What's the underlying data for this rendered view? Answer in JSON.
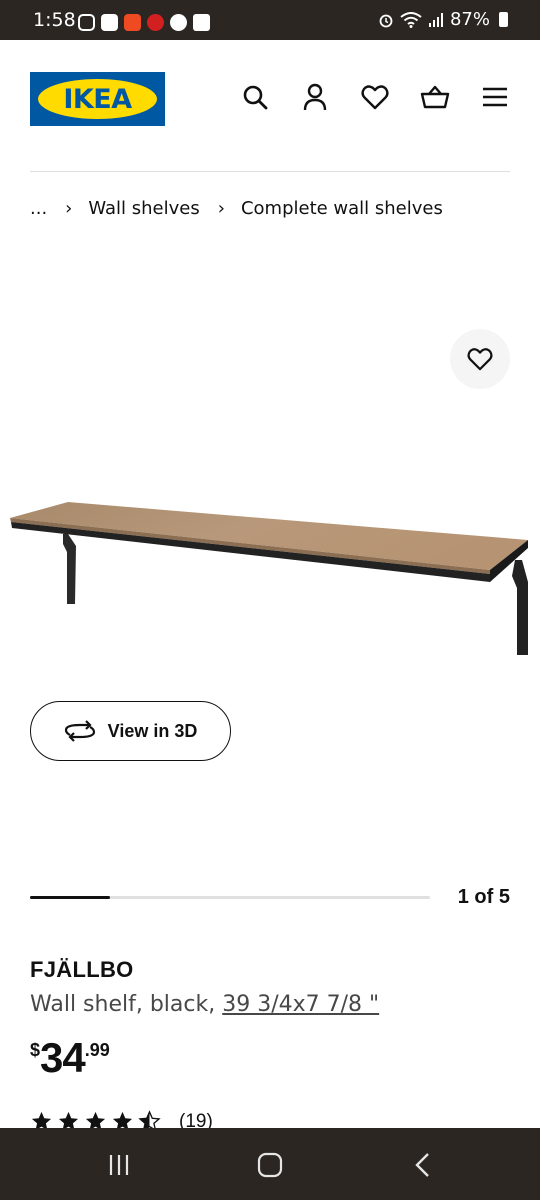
{
  "status_bar": {
    "time": "1:58",
    "battery": "87%"
  },
  "header": {
    "logo_text": "IKEA",
    "icons": [
      "search-icon",
      "account-icon",
      "heart-icon",
      "basket-icon",
      "menu-icon"
    ]
  },
  "breadcrumb": {
    "ellipsis": "...",
    "items": [
      "Wall shelves",
      "Complete wall shelves"
    ],
    "separator": "›"
  },
  "gallery": {
    "view3d_label": "View in 3D",
    "page_text": "1 of 5",
    "page_current": 1,
    "page_total": 5
  },
  "product": {
    "name": "FJÄLLBO",
    "desc_prefix": "Wall shelf, black, ",
    "size": "39 3/4x7 7/8 \"",
    "price_currency": "$",
    "price_int": "34",
    "price_dec": ".99",
    "rating_value": 4.5,
    "rating_count": "(19)"
  },
  "colors": {
    "ikea_blue": "#0058a3",
    "ikea_yellow": "#ffdb00",
    "system_bar": "#2b2622"
  }
}
